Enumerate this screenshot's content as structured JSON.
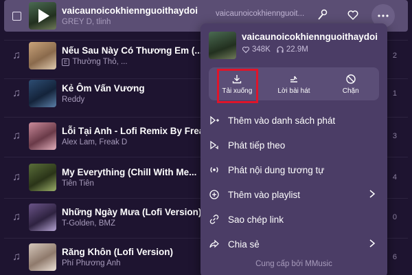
{
  "songs": [
    {
      "title": "vaicaunoicokhiennguoithaydoi",
      "artists": "GREY D, tlinh",
      "album": "vaicaunoicokhiennguoit...",
      "duration": ""
    },
    {
      "title": "Nếu Sau Này Có Thương Em (...",
      "artists": "Thường Thỏ, ...",
      "album": "",
      "duration": "2"
    },
    {
      "title": "Kẻ Ôm Vấn Vương",
      "artists": "Reddy",
      "album": "",
      "duration": "1"
    },
    {
      "title": "Lỗi Tại Anh - Lofi Remix By Freak...",
      "artists": "Alex Lam, Freak D",
      "album": "",
      "duration": "3"
    },
    {
      "title": "My Everything (Chill With Me...",
      "artists": "Tiên Tiên",
      "album": "",
      "duration": "4"
    },
    {
      "title": "Những Ngày Mưa (Lofi Version)",
      "artists": "T-Golden, BMZ",
      "album": "",
      "duration": "0"
    },
    {
      "title": "Răng Khôn (Lofi Version)",
      "artists": "Phí Phương Anh",
      "album": "",
      "duration": "6"
    }
  ],
  "menu": {
    "title": "vaicaunoicokhiennguoithaydoi",
    "likes": "348K",
    "listens": "22.9M",
    "actions": [
      {
        "label": "Tải xuống",
        "icon": "download-icon"
      },
      {
        "label": "Lời bài hát",
        "icon": "lyrics-icon"
      },
      {
        "label": "Chặn",
        "icon": "block-icon"
      }
    ],
    "items": [
      {
        "label": "Thêm vào danh sách phát",
        "icon": "queue-add-icon"
      },
      {
        "label": "Phát tiếp theo",
        "icon": "play-next-icon"
      },
      {
        "label": "Phát nội dung tương tự",
        "icon": "radio-icon"
      },
      {
        "label": "Thêm vào playlist",
        "icon": "plus-circle-icon"
      },
      {
        "label": "Sao chép link",
        "icon": "link-icon"
      },
      {
        "label": "Chia sẻ",
        "icon": "share-icon"
      }
    ],
    "footer": "Cung cấp bởi MMusic"
  },
  "colors": {
    "background": "#1e1430",
    "menu": "#4b3d66",
    "highlight": "#e0142a"
  }
}
